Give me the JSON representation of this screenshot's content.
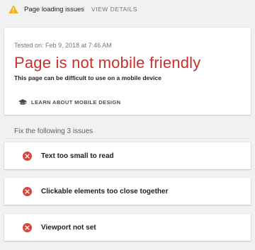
{
  "colors": {
    "warning": "#f2b21f",
    "error": "#d9443c",
    "headline": "#c9302c"
  },
  "topbar": {
    "icon": "warning-icon",
    "message": "Page loading issues",
    "link_label": "VIEW DETAILS"
  },
  "result": {
    "tested_on": "Tested on: Feb 9, 2018 at 7:46 AM",
    "headline": "Page is not mobile friendly",
    "subline": "This page can be difficult to use on a mobile device",
    "learn_icon": "graduation-cap-icon",
    "learn_label": "LEARN ABOUT MOBILE DESIGN"
  },
  "issues": {
    "heading": "Fix the following 3 issues",
    "icon": "error-circle-icon",
    "items": [
      {
        "label": "Text too small to read"
      },
      {
        "label": "Clickable elements too close together"
      },
      {
        "label": "Viewport not set"
      }
    ]
  }
}
